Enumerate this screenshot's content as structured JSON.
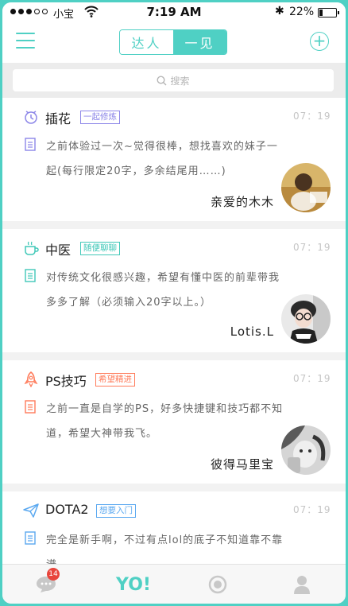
{
  "status": {
    "carrier": "小宝",
    "time": "7:19 AM",
    "battery_pct_label": "22%",
    "battery_level": 0.22
  },
  "nav": {
    "tabs": [
      {
        "label": "达人"
      },
      {
        "label": "一见"
      }
    ],
    "active_tab": 1
  },
  "search": {
    "placeholder": "搜索"
  },
  "colors": {
    "accent": "#4fd0c4",
    "purple": "#8c86e8",
    "teal": "#40c8b8",
    "orange": "#ff7b5a",
    "blue": "#5aa8f0"
  },
  "cards": [
    {
      "icon": "clock-icon",
      "title": "插花",
      "tag": "一起修炼",
      "time": "07：19",
      "desc": "之前体验过一次~觉得很棒，想找喜欢的妹子一起(每行限定20字，多余结尾用……)",
      "author": "亲爱的木木"
    },
    {
      "icon": "coffee-cup-icon",
      "title": "中医",
      "tag": "随便聊聊",
      "time": "07：19",
      "desc": "对传统文化很感兴趣，希望有懂中医的前辈带我多多了解（必须输入20字以上。）",
      "author": "Lotis.L"
    },
    {
      "icon": "rocket-icon",
      "title": "PS技巧",
      "tag": "希望精进",
      "time": "07：19",
      "desc": "之前一直是自学的PS，好多快捷键和技巧都不知道，希望大神带我飞。",
      "author": "彼得马里宝"
    },
    {
      "icon": "paper-plane-icon",
      "title": "DOTA2",
      "tag": "想要入门",
      "time": "07：19",
      "desc": "完全是新手啊，不过有点lol的底子不知道靠不靠谱……",
      "author": ""
    }
  ],
  "tabbar": {
    "message_badge": "14",
    "yo_label": "YO!"
  }
}
